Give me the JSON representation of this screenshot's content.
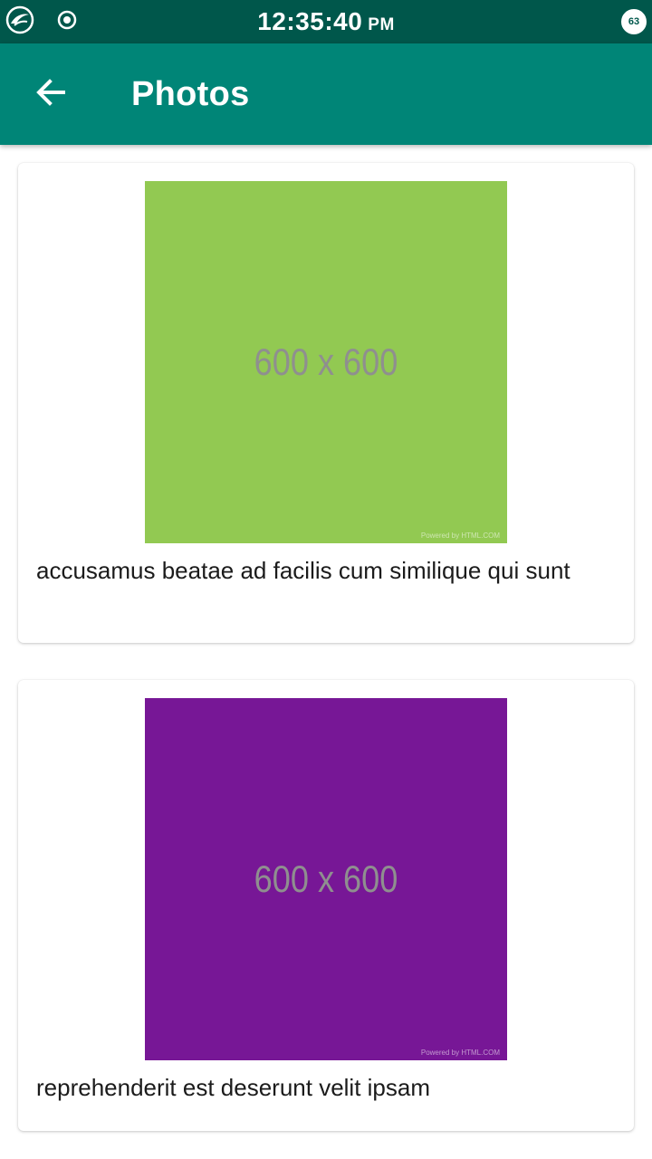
{
  "status_bar": {
    "time": "12:35:40",
    "ampm": "PM",
    "battery_level": "63",
    "left_icons": [
      "app-logo-icon",
      "radio-target-icon"
    ]
  },
  "app_bar": {
    "title": "Photos",
    "back_icon": "arrow-left-icon"
  },
  "photos": [
    {
      "caption": "accusamus beatae ad facilis cum similique qui sunt",
      "placeholder_text": "600 x 600",
      "powered_text": "Powered by HTML.COM",
      "color": "#92c952"
    },
    {
      "caption": "reprehenderit est deserunt velit ipsam",
      "placeholder_text": "600 x 600",
      "powered_text": "Powered by HTML.COM",
      "color": "#771796"
    }
  ],
  "colors": {
    "status_bar": "#00574b",
    "app_bar": "#008577",
    "text": "#1b1b1b"
  }
}
